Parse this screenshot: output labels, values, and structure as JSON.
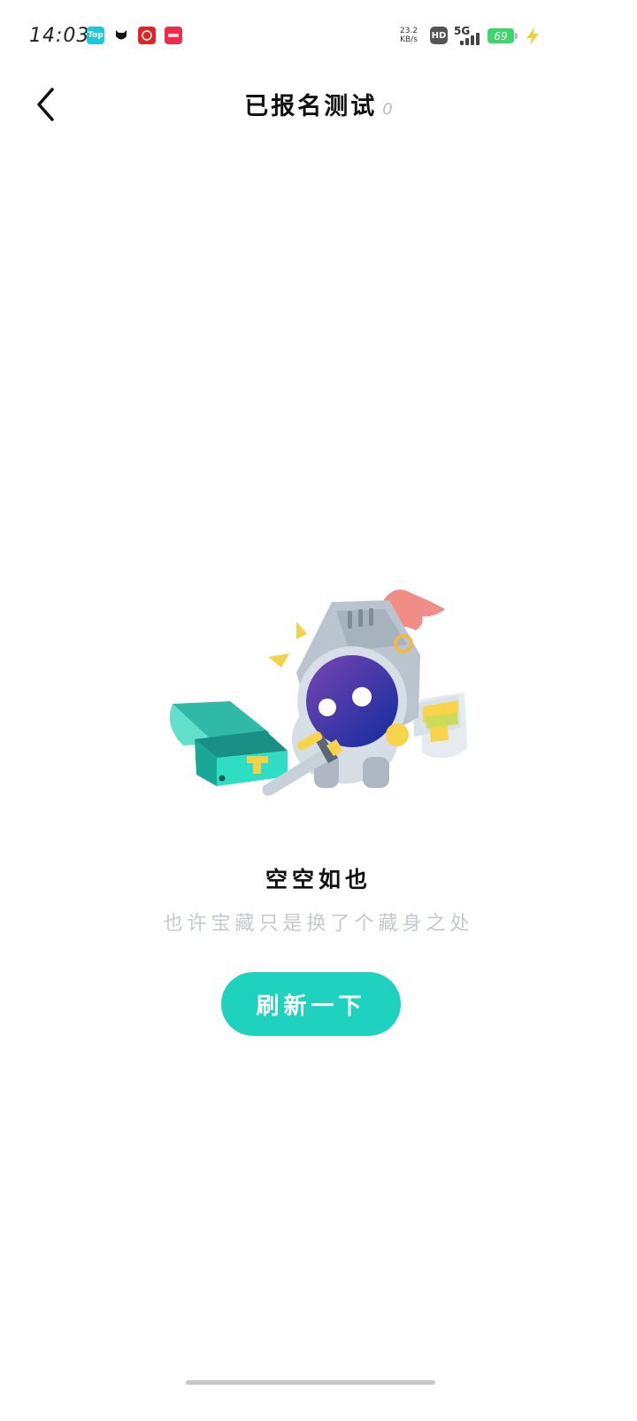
{
  "status_bar": {
    "time": "14:03",
    "net_speed_value": "23.2",
    "net_speed_unit": "KB/s",
    "hd_label": "HD",
    "network_label": "5G",
    "battery_level": "69",
    "apps": [
      {
        "name": "top-app-icon",
        "label": "Top",
        "color": "#20c7d7"
      },
      {
        "name": "cat-app-icon",
        "label": "",
        "color": "#000000"
      },
      {
        "name": "gift-app-icon",
        "label": "",
        "color": "#e02323"
      },
      {
        "name": "shop-app-icon",
        "label": "",
        "color": "#ef2b4a"
      }
    ]
  },
  "header": {
    "title": "已报名测试",
    "count": "0"
  },
  "empty_state": {
    "title": "空空如也",
    "subtitle": "也许宝藏只是换了个藏身之处",
    "button_label": "刷新一下"
  },
  "colors": {
    "accent": "#1ed2bf",
    "subtitle": "#c4c9d2"
  }
}
